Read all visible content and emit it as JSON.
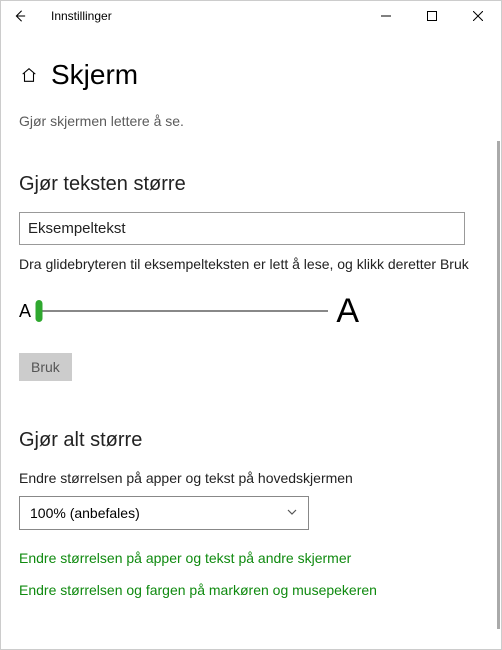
{
  "window": {
    "title": "Innstillinger"
  },
  "page": {
    "title": "Skjerm",
    "subtitle": "Gjør skjermen lettere å se."
  },
  "textSize": {
    "heading": "Gjør teksten større",
    "sample": "Eksempeltekst",
    "instruction": "Dra glidebryteren til eksempelteksten er lett å lese, og klikk deretter Bruk",
    "smallA": "A",
    "bigA": "A",
    "applyLabel": "Bruk"
  },
  "scaling": {
    "heading": "Gjør alt større",
    "label": "Endre størrelsen på apper og tekst på hovedskjermen",
    "selected": "100% (anbefales)",
    "link1": "Endre størrelsen på apper og tekst på andre skjermer",
    "link2": "Endre størrelsen og fargen på markøren og musepekeren"
  }
}
